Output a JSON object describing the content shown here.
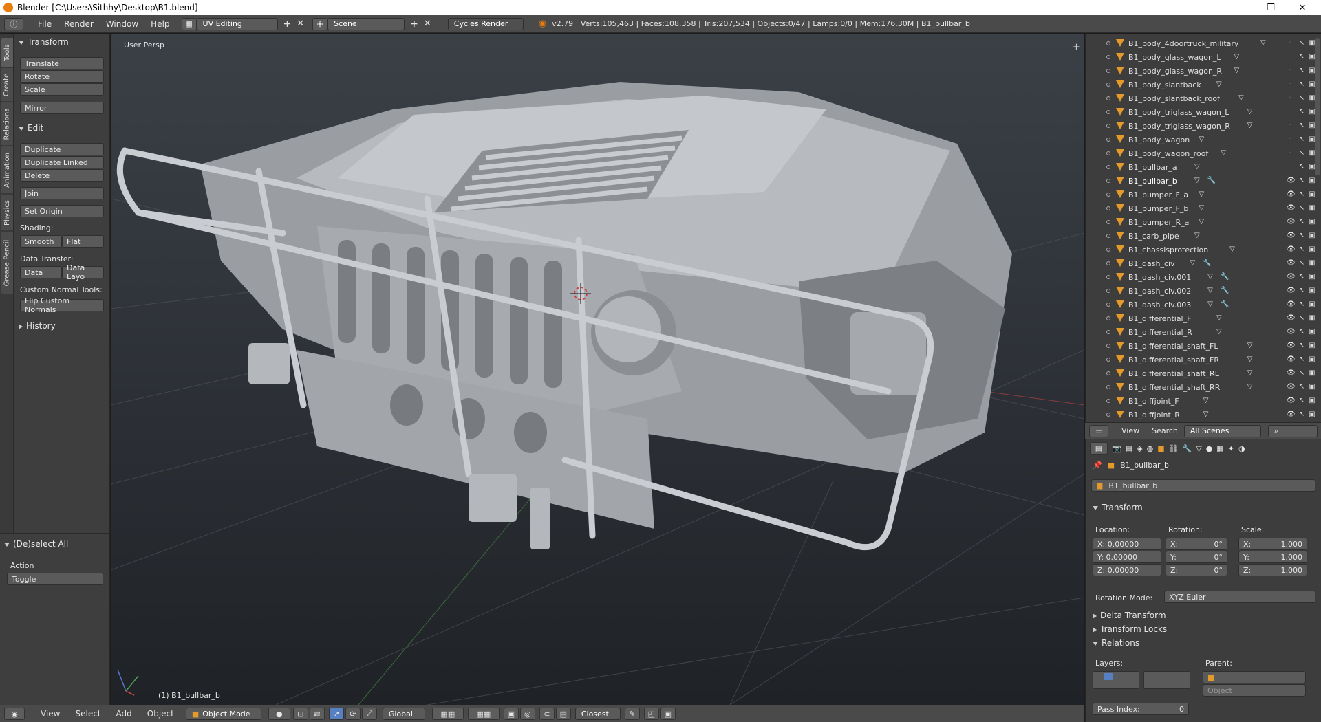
{
  "window": {
    "title": "Blender [C:\\Users\\Sithhy\\Desktop\\B1.blend]",
    "controls": [
      "—",
      "❐",
      "✕"
    ]
  },
  "info_header": {
    "menus": [
      "File",
      "Render",
      "Window",
      "Help"
    ],
    "layout": "UV Editing",
    "scene": "Scene",
    "engine": "Cycles Render",
    "stats": "v2.79 | Verts:105,463 | Faces:108,358 | Tris:207,534 | Objects:0/47 | Lamps:0/0 | Mem:176.30M | B1_bullbar_b"
  },
  "tool_tabs": [
    "Tools",
    "Create",
    "Relations",
    "Animation",
    "Physics",
    "Grease Pencil"
  ],
  "toolshelf": {
    "transform_header": "Transform",
    "translate": "Translate",
    "rotate": "Rotate",
    "scale": "Scale",
    "mirror": "Mirror",
    "edit_header": "Edit",
    "duplicate": "Duplicate",
    "duplicate_linked": "Duplicate Linked",
    "delete": "Delete",
    "join": "Join",
    "set_origin": "Set Origin",
    "shading_label": "Shading:",
    "smooth": "Smooth",
    "flat": "Flat",
    "data_transfer_label": "Data Transfer:",
    "data": "Data",
    "data_layo": "Data Layo",
    "custom_normal_label": "Custom Normal Tools:",
    "flip_normals": "Flip Custom Normals",
    "history": "History"
  },
  "operator_panel": {
    "header": "(De)select All",
    "action_label": "Action",
    "action_value": "Toggle"
  },
  "viewport": {
    "view_label": "User Persp",
    "object_label": "(1) B1_bullbar_b"
  },
  "bottom_header": {
    "menus": [
      "View",
      "Select",
      "Add",
      "Object"
    ],
    "mode": "Object Mode",
    "orientation": "Global",
    "snap": "Closest"
  },
  "outliner": {
    "items": [
      {
        "name": "B1_body_4doortruck_military",
        "wrench": false,
        "visible": false
      },
      {
        "name": "B1_body_glass_wagon_L",
        "wrench": false,
        "visible": false
      },
      {
        "name": "B1_body_glass_wagon_R",
        "wrench": false,
        "visible": false
      },
      {
        "name": "B1_body_slantback",
        "wrench": false,
        "visible": false
      },
      {
        "name": "B1_body_slantback_roof",
        "wrench": false,
        "visible": false
      },
      {
        "name": "B1_body_triglass_wagon_L",
        "wrench": false,
        "visible": false
      },
      {
        "name": "B1_body_triglass_wagon_R",
        "wrench": false,
        "visible": false
      },
      {
        "name": "B1_body_wagon",
        "wrench": false,
        "visible": false
      },
      {
        "name": "B1_body_wagon_roof",
        "wrench": false,
        "visible": false
      },
      {
        "name": "B1_bullbar_a",
        "wrench": false,
        "visible": false
      },
      {
        "name": "B1_bullbar_b",
        "wrench": true,
        "visible": true,
        "active": true
      },
      {
        "name": "B1_bumper_F_a",
        "wrench": false,
        "visible": true
      },
      {
        "name": "B1_bumper_F_b",
        "wrench": false,
        "visible": true
      },
      {
        "name": "B1_bumper_R_a",
        "wrench": false,
        "visible": true
      },
      {
        "name": "B1_carb_pipe",
        "wrench": false,
        "visible": true
      },
      {
        "name": "B1_chassisprotection",
        "wrench": false,
        "visible": true
      },
      {
        "name": "B1_dash_civ",
        "wrench": true,
        "visible": true
      },
      {
        "name": "B1_dash_civ.001",
        "wrench": true,
        "visible": true
      },
      {
        "name": "B1_dash_civ.002",
        "wrench": true,
        "visible": true
      },
      {
        "name": "B1_dash_civ.003",
        "wrench": true,
        "visible": true
      },
      {
        "name": "B1_differential_F",
        "wrench": false,
        "visible": true
      },
      {
        "name": "B1_differential_R",
        "wrench": false,
        "visible": true
      },
      {
        "name": "B1_differential_shaft_FL",
        "wrench": false,
        "visible": true
      },
      {
        "name": "B1_differential_shaft_FR",
        "wrench": false,
        "visible": true
      },
      {
        "name": "B1_differential_shaft_RL",
        "wrench": false,
        "visible": true
      },
      {
        "name": "B1_differential_shaft_RR",
        "wrench": false,
        "visible": true
      },
      {
        "name": "B1_diffjoint_F",
        "wrench": false,
        "visible": true
      },
      {
        "name": "B1_diffjoint_R",
        "wrench": false,
        "visible": true
      }
    ],
    "footer": {
      "view": "View",
      "search": "Search",
      "scope": "All Scenes"
    }
  },
  "properties": {
    "object_name": "B1_bullbar_b",
    "transform_header": "Transform",
    "location_label": "Location:",
    "rotation_label": "Rotation:",
    "scale_label": "Scale:",
    "location": {
      "x": "X:  0.00000",
      "y": "Y:  0.00000",
      "z": "Z:  0.00000"
    },
    "rotation": {
      "x": "X:",
      "y": "Y:",
      "z": "Z:",
      "xv": "0°",
      "yv": "0°",
      "zv": "0°"
    },
    "scale": {
      "x": "X:",
      "y": "Y:",
      "z": "Z:",
      "xv": "1.000",
      "yv": "1.000",
      "zv": "1.000"
    },
    "rotation_mode_label": "Rotation Mode:",
    "rotation_mode": "XYZ Euler",
    "delta_transform": "Delta Transform",
    "transform_locks": "Transform Locks",
    "relations": "Relations",
    "layers_label": "Layers:",
    "parent_label": "Parent:",
    "parent_type": "Object",
    "pass_index_label": "Pass Index:",
    "pass_index": "0"
  },
  "colors": {
    "accent_orange": "#e87d0d",
    "selection_blue": "#5680c2"
  }
}
